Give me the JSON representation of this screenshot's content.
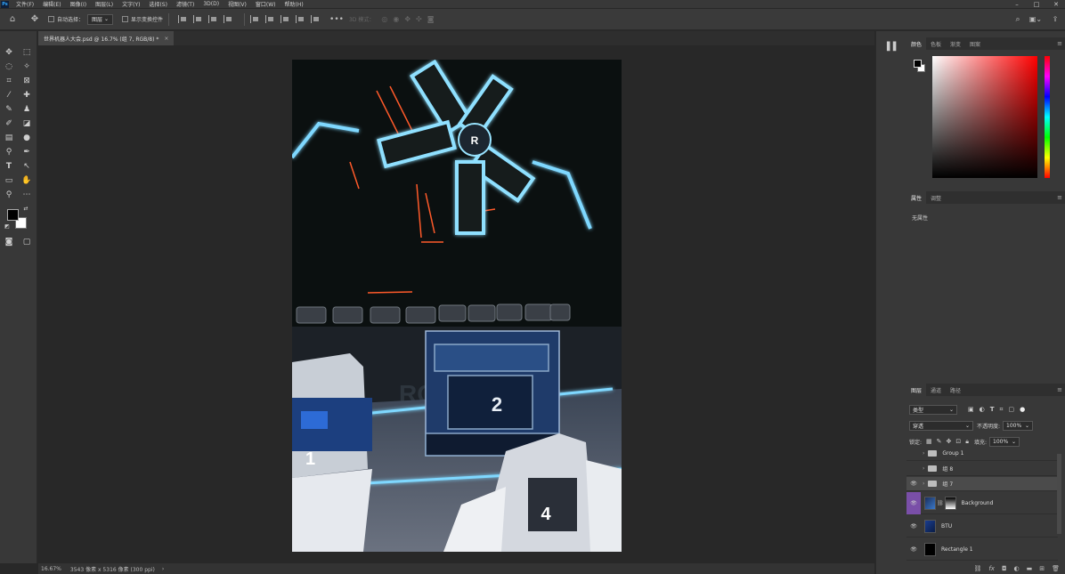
{
  "menubar": {
    "logo": "Ps",
    "items": [
      "文件(F)",
      "编辑(E)",
      "图像(I)",
      "图层(L)",
      "文字(Y)",
      "选择(S)",
      "滤镜(T)",
      "3D(D)",
      "视图(V)",
      "窗口(W)",
      "帮助(H)"
    ]
  },
  "options": {
    "auto_select_label": "自动选择：",
    "auto_select_value": "图层",
    "show_transform_label": "显示变换控件",
    "mode_3d_label": "3D 模式："
  },
  "document": {
    "tab_title": "世界机器人大会.psd @ 16.7% (组 7, RGB/8) *",
    "close_glyph": "×"
  },
  "status": {
    "zoom": "16.67%",
    "doc_size": "3543 像素 x 5316 像素 (300 ppi)"
  },
  "panels": {
    "color_tabs": [
      "颜色",
      "色板",
      "渐变",
      "图案"
    ],
    "properties_tabs": [
      "属性",
      "调整"
    ],
    "no_properties": "无属性",
    "layers_tabs": [
      "图层",
      "通道",
      "路径"
    ],
    "filter_kind": "类型",
    "blend_mode": "穿透",
    "opacity_label": "不透明度:",
    "opacity_value": "100%",
    "lock_label": "锁定:",
    "fill_label": "填充:",
    "fill_value": "100%"
  },
  "layers": [
    {
      "name": "Group 1",
      "type": "group",
      "visible": false
    },
    {
      "name": "组 8",
      "type": "group",
      "visible": false
    },
    {
      "name": "组 7",
      "type": "group",
      "visible": true,
      "selected": true
    },
    {
      "name": "Background",
      "type": "smart",
      "visible": true
    },
    {
      "name": "BTU",
      "type": "image",
      "visible": true
    },
    {
      "name": "Rectangle 1",
      "type": "image",
      "visible": true
    }
  ],
  "artwork": {
    "numbers": [
      "2",
      "1",
      "4"
    ],
    "logo_letter": "R",
    "banner_text": "RO    ER"
  },
  "colors": {
    "foreground": "#000000",
    "background": "#ffffff",
    "accent_glow": "#6fd2ff",
    "selected_row": "#4b4b4b",
    "eye_highlight": "#7a4fa8"
  }
}
